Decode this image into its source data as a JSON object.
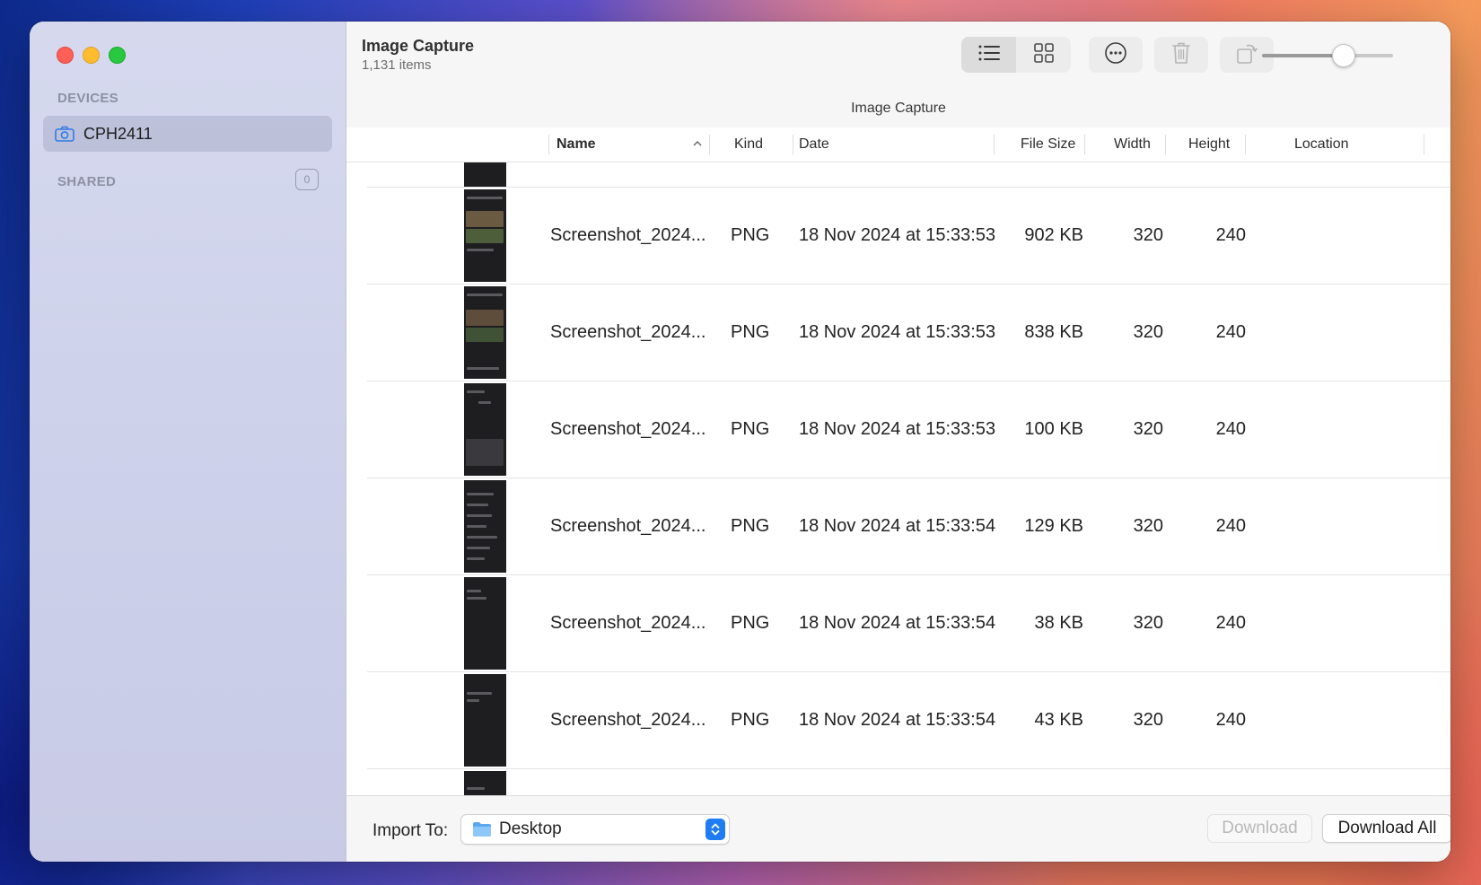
{
  "window": {
    "traffic_lights": [
      "close",
      "minimize",
      "zoom"
    ]
  },
  "sidebar": {
    "devices_header": "DEVICES",
    "device": {
      "label": "CPH2411",
      "icon": "camera-icon"
    },
    "shared_header": "SHARED",
    "shared_count": "0"
  },
  "toolbar": {
    "title": "Image Capture",
    "subtitle": "1,131 items",
    "center_title": "Image Capture",
    "icons": [
      "list-view-icon",
      "grid-view-icon",
      "more-icon",
      "trash-icon",
      "rotate-icon"
    ],
    "thumbnail_size_fraction": 0.75
  },
  "table": {
    "columns": {
      "name": "Name",
      "kind": "Kind",
      "date": "Date",
      "file_size": "File Size",
      "width": "Width",
      "height": "Height",
      "location": "Location"
    },
    "sort": {
      "column": "Name",
      "direction": "ascending"
    },
    "rows": [
      {
        "name": "Screenshot_2024...",
        "kind": "PNG",
        "date": "18 Nov 2024 at 15:33:53",
        "file_size": "902 KB",
        "width": "320",
        "height": "240",
        "location": ""
      },
      {
        "name": "Screenshot_2024...",
        "kind": "PNG",
        "date": "18 Nov 2024 at 15:33:53",
        "file_size": "838 KB",
        "width": "320",
        "height": "240",
        "location": ""
      },
      {
        "name": "Screenshot_2024...",
        "kind": "PNG",
        "date": "18 Nov 2024 at 15:33:53",
        "file_size": "100 KB",
        "width": "320",
        "height": "240",
        "location": ""
      },
      {
        "name": "Screenshot_2024...",
        "kind": "PNG",
        "date": "18 Nov 2024 at 15:33:54",
        "file_size": "129 KB",
        "width": "320",
        "height": "240",
        "location": ""
      },
      {
        "name": "Screenshot_2024...",
        "kind": "PNG",
        "date": "18 Nov 2024 at 15:33:54",
        "file_size": "38 KB",
        "width": "320",
        "height": "240",
        "location": ""
      },
      {
        "name": "Screenshot_2024...",
        "kind": "PNG",
        "date": "18 Nov 2024 at 15:33:54",
        "file_size": "43 KB",
        "width": "320",
        "height": "240",
        "location": ""
      }
    ]
  },
  "footer": {
    "import_label": "Import To:",
    "import_value": "Desktop",
    "download_label": "Download",
    "download_all_label": "Download All"
  },
  "colors": {
    "accent": "#1f7cf3",
    "close": "#fe5f57",
    "minimize": "#febc2e",
    "zoom": "#28c840"
  }
}
